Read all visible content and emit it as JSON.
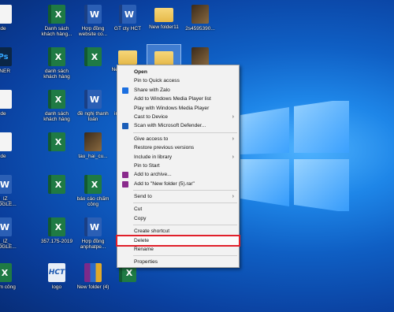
{
  "desktop": {
    "icons": [
      {
        "label": "de",
        "type": "blank"
      },
      {
        "label": "Danh sách khách hàng...",
        "type": "excel"
      },
      {
        "label": "Hợp đồng website co...",
        "type": "word"
      },
      {
        "label": "GT cty HCT",
        "type": "word"
      },
      {
        "label": "New folder11",
        "type": "folder"
      },
      {
        "label": "2s4595390...",
        "type": "img"
      },
      {
        "label": "BNER",
        "type": "ps"
      },
      {
        "label": "danh sách khách hàng",
        "type": "excel"
      },
      {
        "label": "",
        "type": "excel"
      },
      {
        "label": "New folder (5)",
        "type": "folder"
      },
      {
        "label": "Ne...",
        "type": "folder"
      },
      {
        "label": "",
        "type": "img"
      },
      {
        "label": "de",
        "type": "blank"
      },
      {
        "label": "danh sách khách hàng",
        "type": "excel"
      },
      {
        "label": "đề nghị thanh toán",
        "type": "word"
      },
      {
        "label": "inverterso...",
        "type": "excel"
      },
      {
        "label": "de",
        "type": "blank"
      },
      {
        "label": "",
        "type": "excel"
      },
      {
        "label": "tau_hai_cu...",
        "type": "img"
      },
      {
        "label": "",
        "type": "word"
      },
      {
        "label": "I3_IZ_ GOOGLE...",
        "type": "word"
      },
      {
        "label": "",
        "type": "excel"
      },
      {
        "label": "báo cáo chấm công",
        "type": "excel"
      },
      {
        "label": "",
        "type": "word"
      },
      {
        "label": "I3_IZ_ GOOGLE...",
        "type": "word"
      },
      {
        "label": "357.175-2019",
        "type": "excel"
      },
      {
        "label": "Hợp đồng anphatpe...",
        "type": "word"
      },
      {
        "label": "",
        "type": "excel"
      },
      {
        "label": "chấm công",
        "type": "excel"
      },
      {
        "label": "logo",
        "type": "hct"
      },
      {
        "label": "New folder (4)",
        "type": "rar"
      },
      {
        "label": "",
        "type": "excel"
      },
      {
        "label": "mail bản tải nhất",
        "type": "word"
      },
      {
        "label": "Báo giá Định nhất",
        "type": "excel"
      },
      {
        "label": "1EDN6895...",
        "type": "nhat"
      },
      {
        "label": "New folder (6)",
        "type": "rar"
      }
    ]
  },
  "context_menu": {
    "items": [
      {
        "label": "Open",
        "bold": true,
        "icon": "",
        "sep_before": false
      },
      {
        "label": "Pin to Quick access",
        "icon": "",
        "sep_before": false
      },
      {
        "label": "Share with Zalo",
        "icon": "zalo-icon",
        "color": "#1b6fe0",
        "sep_before": false
      },
      {
        "label": "Add to Windows Media Player list",
        "icon": "",
        "sep_before": false
      },
      {
        "label": "Play with Windows Media Player",
        "icon": "",
        "sep_before": false
      },
      {
        "label": "Cast to Device",
        "icon": "",
        "submenu": true,
        "sep_before": false
      },
      {
        "label": "Scan with Microsoft Defender...",
        "icon": "defender-icon",
        "color": "#1b5eb8",
        "sep_before": false
      },
      {
        "label": "Give access to",
        "icon": "",
        "submenu": true,
        "sep_before": true
      },
      {
        "label": "Restore previous versions",
        "icon": "",
        "sep_before": false
      },
      {
        "label": "Include in library",
        "icon": "",
        "submenu": true,
        "sep_before": false
      },
      {
        "label": "Pin to Start",
        "icon": "",
        "sep_before": false
      },
      {
        "label": "Add to archive...",
        "icon": "winrar-icon",
        "color": "#8a2a8c",
        "sep_before": false
      },
      {
        "label": "Add to \"New folder (5).rar\"",
        "icon": "winrar-icon",
        "color": "#8a2a8c",
        "sep_before": false
      },
      {
        "label": "Send to",
        "icon": "",
        "submenu": true,
        "sep_before": true
      },
      {
        "label": "Cut",
        "icon": "",
        "sep_before": true
      },
      {
        "label": "Copy",
        "icon": "",
        "sep_before": false
      },
      {
        "label": "Create shortcut",
        "icon": "",
        "sep_before": true
      },
      {
        "label": "Delete",
        "icon": "",
        "highlighted": true,
        "sep_before": false
      },
      {
        "label": "Rename",
        "icon": "",
        "sep_before": false
      },
      {
        "label": "Properties",
        "icon": "",
        "sep_before": true
      }
    ],
    "highlight_color": "#e0202a"
  }
}
